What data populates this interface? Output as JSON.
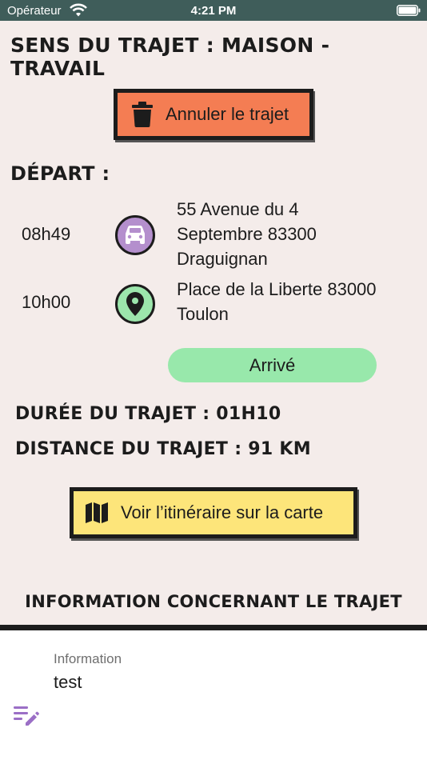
{
  "status_bar": {
    "carrier": "Opérateur",
    "time": "4:21 PM"
  },
  "trip": {
    "title": "Sens du trajet : Maison - Travail",
    "cancel_label": "Annuler le trajet",
    "departure_heading": "Départ :",
    "departure": {
      "time": "08h49",
      "address_line1": "55 Avenue du 4",
      "address_line2": "Septembre 83300",
      "address_line3": "Draguignan"
    },
    "arrival": {
      "time": "10h00",
      "address_line1": "Place de la Liberte 83000",
      "address_line2": "Toulon"
    },
    "arrived_label": "Arrivé",
    "duration_text": "Durée du trajet : 01h10",
    "distance_text": "Distance du trajet : 91 km",
    "map_label": "Voir l’itinéraire sur la carte",
    "info_heading": "Information concernant le trajet"
  },
  "info": {
    "field_label": "Information",
    "field_value": "test"
  },
  "colors": {
    "background": "#f4ecea",
    "status_bar": "#3f5d5a",
    "cancel_button": "#f47d53",
    "car_circle": "#b48fcd",
    "pin_circle": "#9ce6ac",
    "arrived_button": "#98e8ab",
    "map_button": "#fde57a",
    "edit_icon": "#9b6fc6"
  },
  "icons": {
    "cancel": "trash-icon",
    "departure": "car-icon",
    "arrival": "location-pin-icon",
    "map": "map-icon",
    "edit": "edit-notes-icon"
  }
}
